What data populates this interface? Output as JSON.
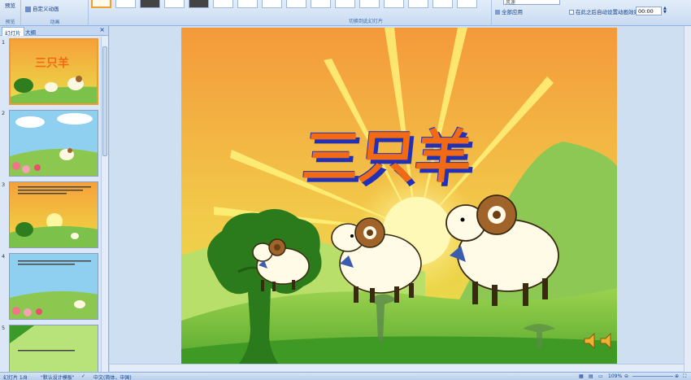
{
  "ribbon": {
    "preview_label": "预览",
    "preview_group": "预览",
    "custom_anim_label": "自定义动画",
    "anim_group": "动画",
    "transition_group": "切换到此幻灯片",
    "sound_value": "风速",
    "apply_all_label": "全部应用",
    "auto_after_label": "在此之后自动设置动画效果:",
    "auto_after_value": "00:00"
  },
  "pane": {
    "tab_slides": "幻灯片",
    "tab_outline": "大纲",
    "close": "×",
    "slide_numbers": [
      "1",
      "2",
      "3",
      "4",
      "5"
    ]
  },
  "slide": {
    "title": "三只羊"
  },
  "status": {
    "slide_counter": "幻灯片 1/8",
    "theme": "\"默认设计模板\"",
    "language": "中文(简体，中国)",
    "zoom": "109%"
  },
  "colors": {
    "title_fill": "#f26a14",
    "title_shadow": "#2031b8",
    "sky_top": "#f6a13a",
    "sky_bottom": "#eddc45",
    "hill": "#6bb23a",
    "tree": "#2e7d1f"
  }
}
